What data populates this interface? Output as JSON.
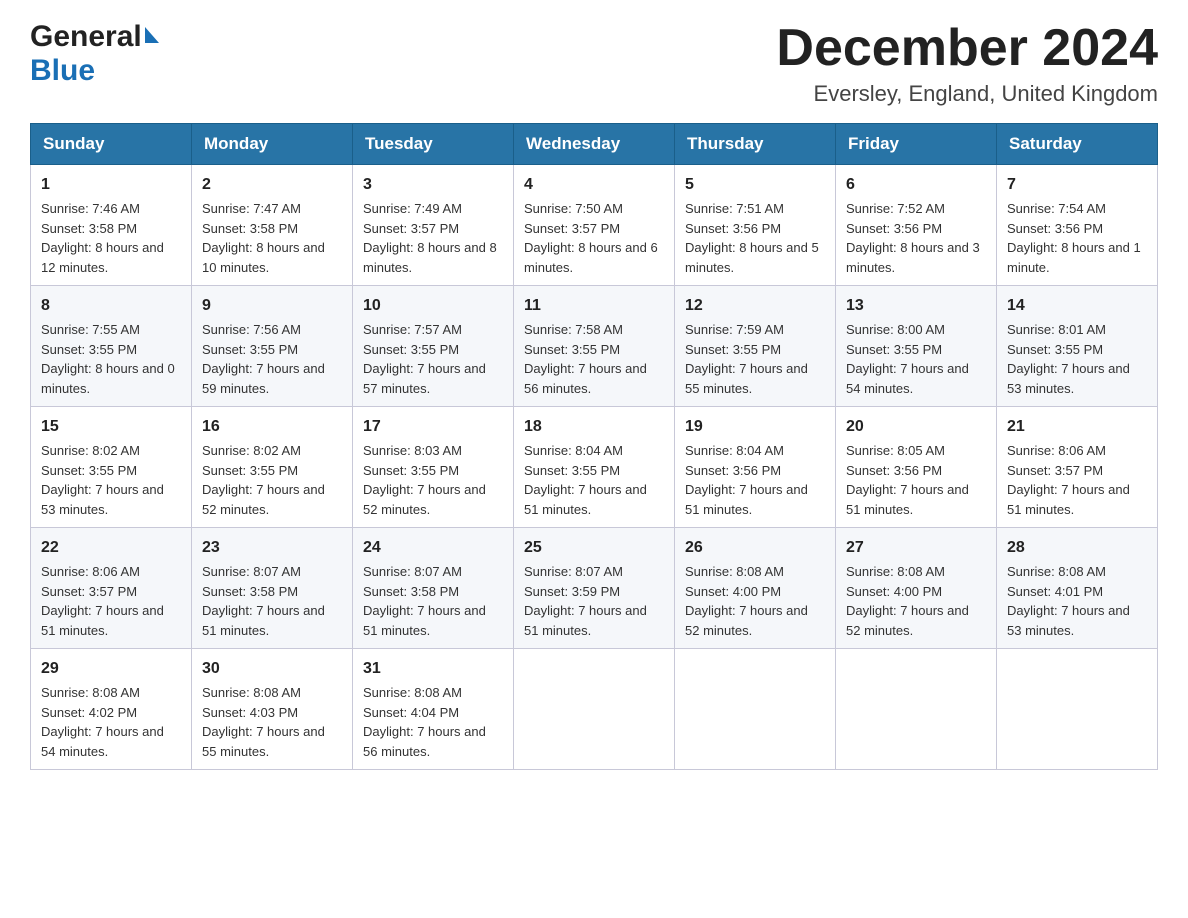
{
  "header": {
    "logo_general": "General",
    "logo_blue": "Blue",
    "month_title": "December 2024",
    "location": "Eversley, England, United Kingdom"
  },
  "weekdays": [
    "Sunday",
    "Monday",
    "Tuesday",
    "Wednesday",
    "Thursday",
    "Friday",
    "Saturday"
  ],
  "weeks": [
    [
      {
        "day": "1",
        "sunrise": "7:46 AM",
        "sunset": "3:58 PM",
        "daylight": "8 hours and 12 minutes."
      },
      {
        "day": "2",
        "sunrise": "7:47 AM",
        "sunset": "3:58 PM",
        "daylight": "8 hours and 10 minutes."
      },
      {
        "day": "3",
        "sunrise": "7:49 AM",
        "sunset": "3:57 PM",
        "daylight": "8 hours and 8 minutes."
      },
      {
        "day": "4",
        "sunrise": "7:50 AM",
        "sunset": "3:57 PM",
        "daylight": "8 hours and 6 minutes."
      },
      {
        "day": "5",
        "sunrise": "7:51 AM",
        "sunset": "3:56 PM",
        "daylight": "8 hours and 5 minutes."
      },
      {
        "day": "6",
        "sunrise": "7:52 AM",
        "sunset": "3:56 PM",
        "daylight": "8 hours and 3 minutes."
      },
      {
        "day": "7",
        "sunrise": "7:54 AM",
        "sunset": "3:56 PM",
        "daylight": "8 hours and 1 minute."
      }
    ],
    [
      {
        "day": "8",
        "sunrise": "7:55 AM",
        "sunset": "3:55 PM",
        "daylight": "8 hours and 0 minutes."
      },
      {
        "day": "9",
        "sunrise": "7:56 AM",
        "sunset": "3:55 PM",
        "daylight": "7 hours and 59 minutes."
      },
      {
        "day": "10",
        "sunrise": "7:57 AM",
        "sunset": "3:55 PM",
        "daylight": "7 hours and 57 minutes."
      },
      {
        "day": "11",
        "sunrise": "7:58 AM",
        "sunset": "3:55 PM",
        "daylight": "7 hours and 56 minutes."
      },
      {
        "day": "12",
        "sunrise": "7:59 AM",
        "sunset": "3:55 PM",
        "daylight": "7 hours and 55 minutes."
      },
      {
        "day": "13",
        "sunrise": "8:00 AM",
        "sunset": "3:55 PM",
        "daylight": "7 hours and 54 minutes."
      },
      {
        "day": "14",
        "sunrise": "8:01 AM",
        "sunset": "3:55 PM",
        "daylight": "7 hours and 53 minutes."
      }
    ],
    [
      {
        "day": "15",
        "sunrise": "8:02 AM",
        "sunset": "3:55 PM",
        "daylight": "7 hours and 53 minutes."
      },
      {
        "day": "16",
        "sunrise": "8:02 AM",
        "sunset": "3:55 PM",
        "daylight": "7 hours and 52 minutes."
      },
      {
        "day": "17",
        "sunrise": "8:03 AM",
        "sunset": "3:55 PM",
        "daylight": "7 hours and 52 minutes."
      },
      {
        "day": "18",
        "sunrise": "8:04 AM",
        "sunset": "3:55 PM",
        "daylight": "7 hours and 51 minutes."
      },
      {
        "day": "19",
        "sunrise": "8:04 AM",
        "sunset": "3:56 PM",
        "daylight": "7 hours and 51 minutes."
      },
      {
        "day": "20",
        "sunrise": "8:05 AM",
        "sunset": "3:56 PM",
        "daylight": "7 hours and 51 minutes."
      },
      {
        "day": "21",
        "sunrise": "8:06 AM",
        "sunset": "3:57 PM",
        "daylight": "7 hours and 51 minutes."
      }
    ],
    [
      {
        "day": "22",
        "sunrise": "8:06 AM",
        "sunset": "3:57 PM",
        "daylight": "7 hours and 51 minutes."
      },
      {
        "day": "23",
        "sunrise": "8:07 AM",
        "sunset": "3:58 PM",
        "daylight": "7 hours and 51 minutes."
      },
      {
        "day": "24",
        "sunrise": "8:07 AM",
        "sunset": "3:58 PM",
        "daylight": "7 hours and 51 minutes."
      },
      {
        "day": "25",
        "sunrise": "8:07 AM",
        "sunset": "3:59 PM",
        "daylight": "7 hours and 51 minutes."
      },
      {
        "day": "26",
        "sunrise": "8:08 AM",
        "sunset": "4:00 PM",
        "daylight": "7 hours and 52 minutes."
      },
      {
        "day": "27",
        "sunrise": "8:08 AM",
        "sunset": "4:00 PM",
        "daylight": "7 hours and 52 minutes."
      },
      {
        "day": "28",
        "sunrise": "8:08 AM",
        "sunset": "4:01 PM",
        "daylight": "7 hours and 53 minutes."
      }
    ],
    [
      {
        "day": "29",
        "sunrise": "8:08 AM",
        "sunset": "4:02 PM",
        "daylight": "7 hours and 54 minutes."
      },
      {
        "day": "30",
        "sunrise": "8:08 AM",
        "sunset": "4:03 PM",
        "daylight": "7 hours and 55 minutes."
      },
      {
        "day": "31",
        "sunrise": "8:08 AM",
        "sunset": "4:04 PM",
        "daylight": "7 hours and 56 minutes."
      },
      null,
      null,
      null,
      null
    ]
  ],
  "labels": {
    "sunrise_prefix": "Sunrise: ",
    "sunset_prefix": "Sunset: ",
    "daylight_prefix": "Daylight: "
  }
}
